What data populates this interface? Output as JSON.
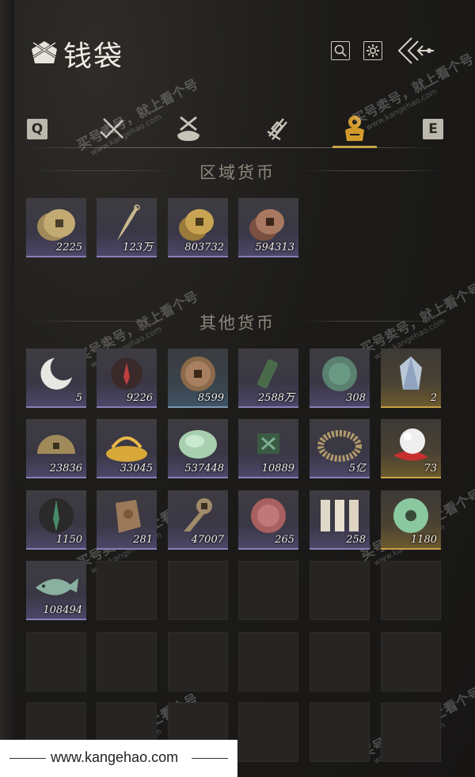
{
  "header": {
    "title": "钱袋"
  },
  "tabs": {
    "left_key": "Q",
    "right_key": "E",
    "active_index": 3
  },
  "sections": {
    "regional": "区域货币",
    "other": "其他货币"
  },
  "regional_items": [
    {
      "name": "coins-stack",
      "qty": "2225",
      "rarity": "item"
    },
    {
      "name": "feather-blade",
      "qty": "123万",
      "rarity": "item"
    },
    {
      "name": "copper-coins",
      "qty": "803732",
      "rarity": "item"
    },
    {
      "name": "bronze-coins",
      "qty": "594313",
      "rarity": "item"
    }
  ],
  "other_items": [
    {
      "name": "crescent-jade",
      "qty": "5",
      "rarity": "item"
    },
    {
      "name": "red-emblem",
      "qty": "9226",
      "rarity": "item"
    },
    {
      "name": "ancient-coin",
      "qty": "8599",
      "rarity": "blue"
    },
    {
      "name": "green-token",
      "qty": "2588万",
      "rarity": "item"
    },
    {
      "name": "jade-coin",
      "qty": "308",
      "rarity": "item"
    },
    {
      "name": "crystal-stone",
      "qty": "2",
      "rarity": "gold"
    },
    {
      "name": "half-coin",
      "qty": "23836",
      "rarity": "item"
    },
    {
      "name": "golden-grain",
      "qty": "33045",
      "rarity": "item"
    },
    {
      "name": "jade-pebble",
      "qty": "537448",
      "rarity": "item"
    },
    {
      "name": "green-card",
      "qty": "10889",
      "rarity": "item"
    },
    {
      "name": "bead-bracelet",
      "qty": "5亿",
      "rarity": "item"
    },
    {
      "name": "white-pearl",
      "qty": "73",
      "rarity": "gold"
    },
    {
      "name": "dark-sigil",
      "qty": "1150",
      "rarity": "item"
    },
    {
      "name": "stone-idol",
      "qty": "281",
      "rarity": "item"
    },
    {
      "name": "spade-coin",
      "qty": "47007",
      "rarity": "item"
    },
    {
      "name": "red-jade-coin",
      "qty": "265",
      "rarity": "item"
    },
    {
      "name": "paper-notes",
      "qty": "258",
      "rarity": "item"
    },
    {
      "name": "jade-ring",
      "qty": "1180",
      "rarity": "gold"
    },
    {
      "name": "jade-fish",
      "qty": "108494",
      "rarity": "item"
    }
  ],
  "watermark": {
    "text": "买号卖号，就上看个号",
    "url": "www.kangehao.com",
    "badge": "看个号"
  },
  "footer": {
    "url": "www.kangehao.com"
  },
  "colors": {
    "accent": "#c9a24a",
    "rarity_purple": "#8a7fb7",
    "rarity_gold": "#c9a24a"
  }
}
